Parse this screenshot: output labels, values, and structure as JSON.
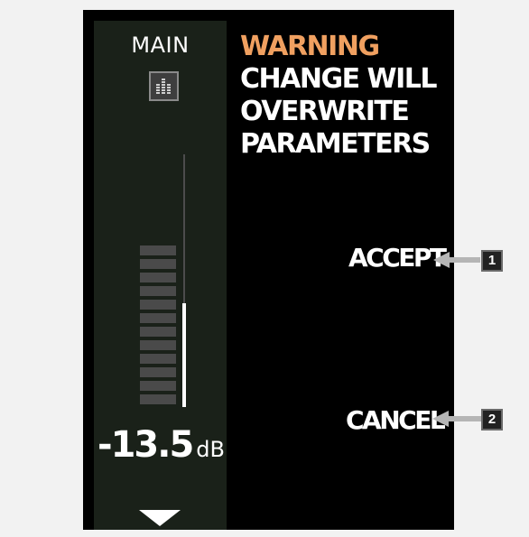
{
  "channel": {
    "name": "MAIN",
    "eq_icon": "eq-bars-icon",
    "meter_segments": 12,
    "fader_fraction": 0.41,
    "level_value": "-13.5",
    "level_unit": "dB",
    "scroll_icon": "triangle-down-icon"
  },
  "dialog": {
    "title": "WARNING",
    "message_lines": [
      "CHANGE WILL",
      "OVERWRITE",
      "PARAMETERS"
    ],
    "accept_label": "ACCEPT",
    "cancel_label": "CANCEL"
  },
  "callouts": {
    "accept_badge": "1",
    "cancel_badge": "2"
  },
  "colors": {
    "warning": "#f0a060",
    "channel_bg": "#1a2119",
    "screen_bg": "#000000",
    "text": "#ffffff",
    "meter_segment": "#4a4a4a"
  }
}
